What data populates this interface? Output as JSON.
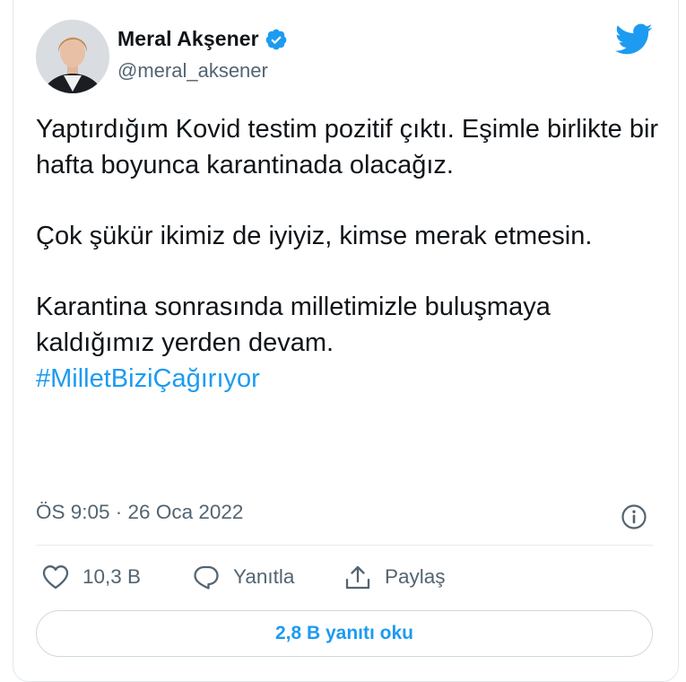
{
  "author": {
    "name": "Meral Akşener",
    "handle": "@meral_aksener"
  },
  "icons": {
    "verified": "verified-badge-icon",
    "logo": "twitter-bird-icon",
    "info": "info-icon",
    "like": "heart-icon",
    "reply": "speech-bubble-icon",
    "share": "share-icon"
  },
  "tweet": {
    "paragraph1": "Yaptırdığım Kovid testim pozitif çıktı. Eşimle birlikte bir hafta boyunca karantinada olacağız.",
    "paragraph2": "Çok şükür ikimiz de iyiyiz, kimse merak etmesin.",
    "paragraph3": "Karantina sonrasında milletimizle buluşmaya kaldığımız yerden devam.",
    "hashtag": "#MilletBiziÇağırıyor"
  },
  "timestamp": "ÖS 9:05 · 26 Oca 2022",
  "actions": {
    "like_count": "10,3 B",
    "reply_label": "Yanıtla",
    "share_label": "Paylaş"
  },
  "read_replies_label": "2,8 B yanıtı oku",
  "colors": {
    "accent": "#1d9bf0",
    "text": "#0f1419",
    "secondary": "#536471",
    "border": "#e1e8ed"
  }
}
